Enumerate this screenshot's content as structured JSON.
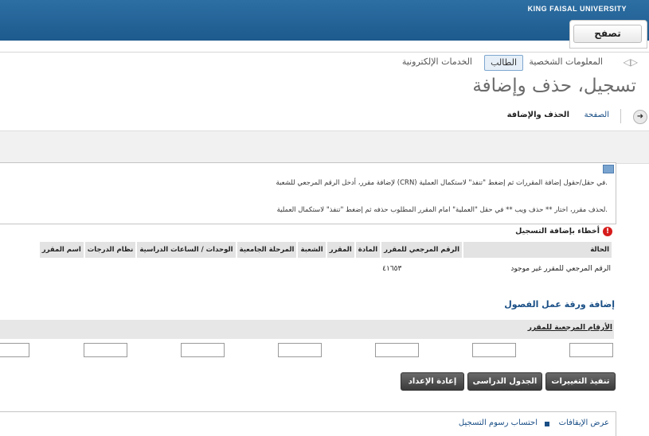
{
  "header": {
    "university": "KING FAISAL UNIVERSITY",
    "browse_label": "تصفح"
  },
  "nav": {
    "back_arrow": "◁",
    "forward_arrow": "▷",
    "tabs": [
      {
        "label": "المعلومات الشخصية"
      },
      {
        "label": "الطالب"
      },
      {
        "label": "الخدمات الإلكترونية"
      }
    ]
  },
  "page": {
    "title": "تسجيل، حذف وإضافة"
  },
  "breadcrumb": {
    "go": "➜",
    "home": "الصفحة",
    "current": "الحذف والإضافة"
  },
  "info": {
    "line1": "لإضافة مقرر، أدخل الرقم المرجعي للشعبة (CRN) في حقل/حقول إضافة المقررات ثم إضغط \"تنفذ\" لاستكمال العملية.",
    "line2": "لحذف مقرر، اختار ** حذف ويب ** في حقل \"العملية\" امام المقرر المطلوب حذفه ثم إضغط \"تنفذ\" لاستكمال العملية."
  },
  "errors": {
    "icon": "!",
    "title": "أخطاء بإضافة التسجيل",
    "columns": [
      "الحالة",
      "الرقم المرجعي للمقرر",
      "المادة",
      "المقرر",
      "الشعبة",
      "المرحلة الجامعية",
      "الوحدات / الساعات الدراسية",
      "نظام الدرجات",
      "اسم المقرر"
    ],
    "rows": [
      {
        "status": "الرقم المرجعي للمقرر غير موجود",
        "crn": "٤١٦٥٣"
      }
    ]
  },
  "worksheet": {
    "title": "إضافة ورقة عمل الفصول",
    "crn_label": "الأرقام المرجعية للمقرر"
  },
  "buttons": {
    "submit": "تنفيذ التغييرات",
    "schedule": "الجدول الدراسى",
    "reset": "إعادة الإعداد"
  },
  "footer": {
    "holds": "عرض الإيقافات",
    "fees": "احتساب رسوم التسجيل"
  }
}
